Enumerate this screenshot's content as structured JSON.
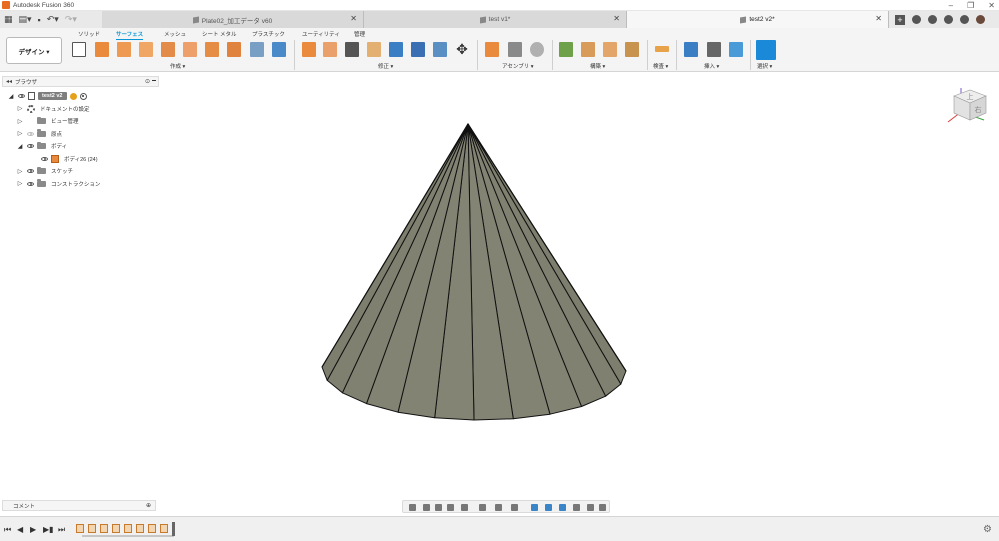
{
  "window": {
    "title": "Autodesk Fusion 360"
  },
  "tabs": [
    {
      "label": "Plate02_加工データ v60",
      "active": false
    },
    {
      "label": "test v1*",
      "active": false
    },
    {
      "label": "test2 v2*",
      "active": true
    }
  ],
  "workspace": {
    "label": "デザイン ▾"
  },
  "ribbon": {
    "tabs": [
      "ソリッド",
      "サーフェス",
      "メッシュ",
      "シート メタル",
      "プラスチック",
      "ユーティリティ",
      "管理"
    ],
    "active_tab": "サーフェス",
    "groups": [
      "作成 ▾",
      "修正 ▾",
      "アセンブリ ▾",
      "構築 ▾",
      "検査 ▾",
      "挿入 ▾",
      "選択 ▾"
    ]
  },
  "browser": {
    "title": "ブラウザ",
    "root": "test2 v2",
    "items": [
      {
        "label": "ドキュメントの設定"
      },
      {
        "label": "ビュー管理"
      },
      {
        "label": "原点"
      },
      {
        "label": "ボディ"
      },
      {
        "label": "ボディ26 (24)"
      },
      {
        "label": "スケッチ"
      },
      {
        "label": "コンストラクション"
      }
    ]
  },
  "comments": {
    "title": "コメント"
  },
  "viewcube": {
    "face_top": "上",
    "face_right": "右"
  },
  "model": {
    "segments": 24
  },
  "colors": {
    "accent": "#0696d7",
    "body": "#7d7c6c",
    "edge": "#111111",
    "background": "#ffffff"
  }
}
